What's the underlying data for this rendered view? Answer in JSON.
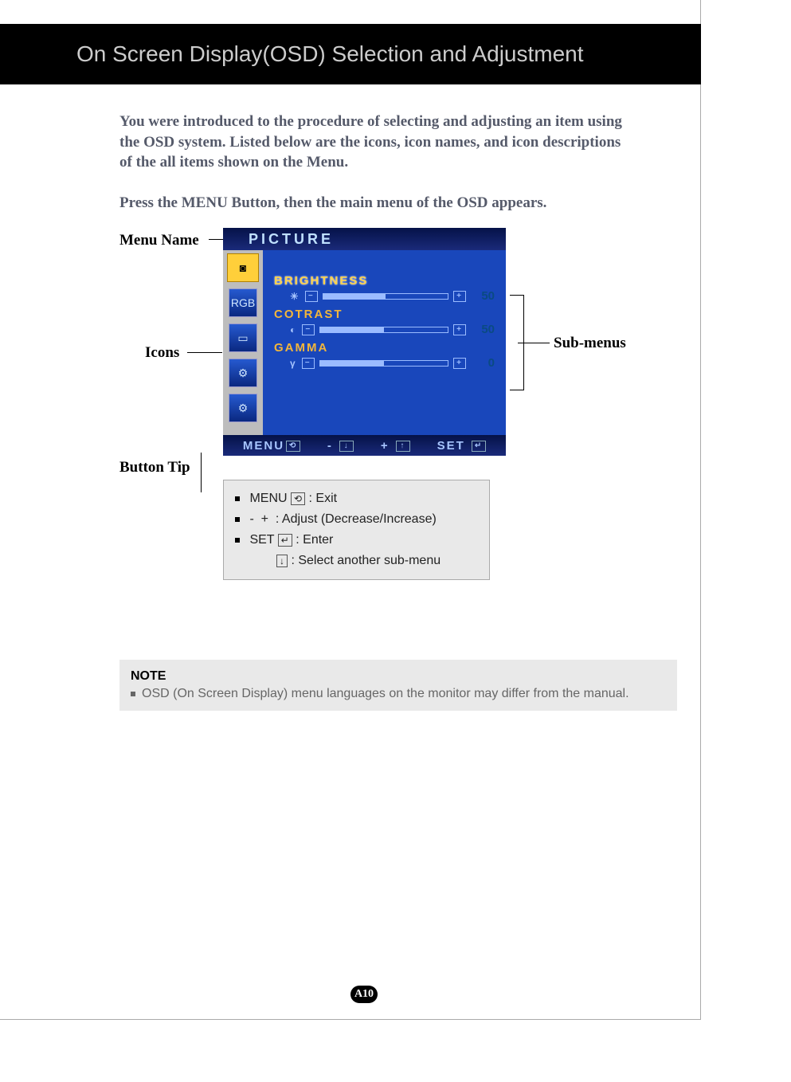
{
  "header": {
    "title": "On Screen Display(OSD) Selection and Adjustment"
  },
  "intro": "You were introduced to the procedure of selecting and adjusting an item using the OSD system.  Listed below are the icons, icon names, and icon descriptions of the all items shown on the Menu.",
  "press_line": "Press the MENU Button, then the main menu of the OSD appears.",
  "labels": {
    "menu_name": "Menu Name",
    "icons": "Icons",
    "button_tip": "Button Tip",
    "sub_menus": "Sub-menus"
  },
  "osd": {
    "title": "PICTURE",
    "rows": [
      {
        "name": "BRIGHTNESS",
        "value": "50",
        "fill_pct": 50,
        "glyph": "☀"
      },
      {
        "name": "COTRAST",
        "value": "50",
        "fill_pct": 50,
        "glyph": "◐"
      },
      {
        "name": "GAMMA",
        "value": "0",
        "fill_pct": 50,
        "glyph": "γ"
      }
    ],
    "footer": {
      "menu": "MENU",
      "minus": "-",
      "plus": "+",
      "set": "SET"
    }
  },
  "tips": {
    "menu": {
      "label": "MENU",
      "desc": ": Exit"
    },
    "adjust": {
      "desc": ": Adjust (Decrease/Increase)"
    },
    "set": {
      "label": "SET",
      "desc": ": Enter"
    },
    "select": {
      "desc": ": Select another sub-menu"
    }
  },
  "note": {
    "heading": "NOTE",
    "text": "OSD (On Screen Display) menu languages on the monitor may differ from the manual."
  },
  "page_number": "A10"
}
